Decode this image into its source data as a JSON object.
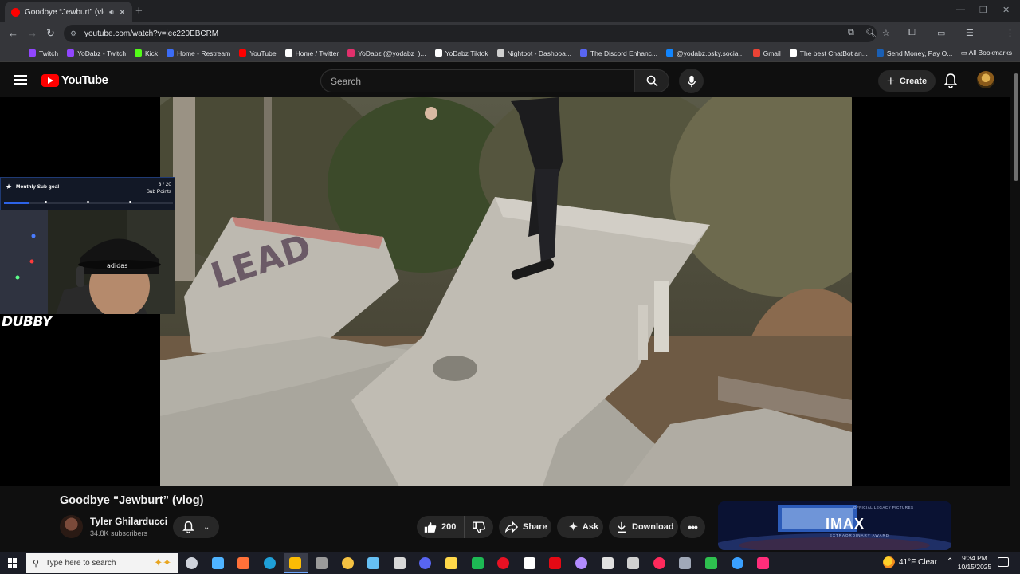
{
  "browser": {
    "tab_title": "Goodbye “Jewburt” (vlog)",
    "url": "youtube.com/watch?v=jec220EBCRM",
    "bookmarks": [
      {
        "label": "Twitch",
        "color": "#9146ff"
      },
      {
        "label": "YoDabz - Twitch",
        "color": "#9146ff"
      },
      {
        "label": "Kick",
        "color": "#53fc18"
      },
      {
        "label": "Home - Restream",
        "color": "#3b6cf6"
      },
      {
        "label": "YouTube",
        "color": "#ff0000"
      },
      {
        "label": "Home / Twitter",
        "color": "#ffffff"
      },
      {
        "label": "YoDabz (@yodabz_)...",
        "color": "#e1306c"
      },
      {
        "label": "YoDabz Tiktok",
        "color": "#ffffff"
      },
      {
        "label": "Nightbot - Dashboa...",
        "color": "#d0d0d0"
      },
      {
        "label": "The Discord Enhanc...",
        "color": "#5865f2"
      },
      {
        "label": "@yodabz.bsky.socia...",
        "color": "#1185fe"
      },
      {
        "label": "Gmail",
        "color": "#ea4335"
      },
      {
        "label": "The best ChatBot an...",
        "color": "#ffffff"
      },
      {
        "label": "Send Money, Pay O...",
        "color": "#1a5fb4"
      }
    ],
    "all_bookmarks_label": "All Bookmarks"
  },
  "youtube": {
    "logo_text": "YouTube",
    "search_placeholder": "Search",
    "create_label": "Create"
  },
  "overlay": {
    "goal_title": "Monthly Sub goal",
    "goal_count": "3 / 20",
    "goal_unit": "Sub Points",
    "goal_progress": 0.15,
    "streamer_name": "DUBBY",
    "cap_logo": "adidas"
  },
  "video": {
    "title": "Goodbye “Jewburt” (vlog)",
    "channel_name": "Tyler Ghilarducci",
    "subscribers": "34.8K subscribers",
    "likes": "200",
    "share_label": "Share",
    "ask_label": "Ask",
    "download_label": "Download"
  },
  "ad": {
    "brand": "IMAX",
    "top_text": "OFFICIAL LEGACY PICTURES",
    "sub_text": "EXTRAORDINARY AWARD"
  },
  "taskbar": {
    "search_placeholder": "Type here to search",
    "apps": [
      {
        "name": "task-view",
        "color": "#cfd3dc"
      },
      {
        "name": "copilot",
        "color": "#4fb3ff"
      },
      {
        "name": "firefox",
        "color": "#ff7139"
      },
      {
        "name": "edge",
        "color": "#1fa0d8"
      },
      {
        "name": "chrome",
        "color": "#fbbc05"
      },
      {
        "name": "obs",
        "color": "#9a9a9a"
      },
      {
        "name": "file-explorer",
        "color": "#f5c242"
      },
      {
        "name": "steam",
        "color": "#66c0f4"
      },
      {
        "name": "epic-games",
        "color": "#d8d8d8"
      },
      {
        "name": "discord",
        "color": "#5865f2"
      },
      {
        "name": "streamlabs",
        "color": "#ffd84a"
      },
      {
        "name": "spotify",
        "color": "#1db954"
      },
      {
        "name": "app-red",
        "color": "#e81123"
      },
      {
        "name": "tiktok",
        "color": "#ffffff"
      },
      {
        "name": "netflix",
        "color": "#e50914"
      },
      {
        "name": "feather",
        "color": "#b38cff"
      },
      {
        "name": "settings",
        "color": "#e0e0e0"
      },
      {
        "name": "monitor",
        "color": "#d0d0d0"
      },
      {
        "name": "opera-gx",
        "color": "#ff2a5c"
      },
      {
        "name": "printer",
        "color": "#a0a8b8"
      },
      {
        "name": "xbox",
        "color": "#2ec04f"
      },
      {
        "name": "app-circle",
        "color": "#3aa0ff"
      },
      {
        "name": "tiktok-live",
        "color": "#ff2d7a"
      }
    ],
    "weather": "41°F  Clear",
    "time": "9:34 PM",
    "date": "10/15/2025"
  }
}
